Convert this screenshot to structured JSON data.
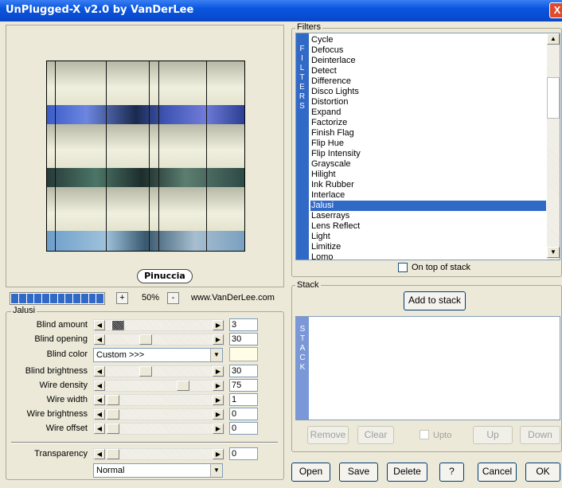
{
  "window": {
    "title": "UnPlugged-X v2.0 by VanDerLee",
    "close_label": "X"
  },
  "preview": {
    "logo_text": "Pinuccia"
  },
  "zoom": {
    "minus": "-",
    "plus": "+",
    "value": "50%"
  },
  "website": "www.VanDerLee.com",
  "jalusi": {
    "group_title": "Jalusi",
    "params": [
      {
        "label": "Blind amount",
        "value": "3",
        "level": 0.05
      },
      {
        "label": "Blind opening",
        "value": "30",
        "level": 0.35
      },
      {
        "label": "Blind brightness",
        "value": "30",
        "level": 0.35
      },
      {
        "label": "Wire density",
        "value": "75",
        "level": 0.75
      },
      {
        "label": "Wire width",
        "value": "1",
        "level": 0.0
      },
      {
        "label": "Wire brightness",
        "value": "0",
        "level": 0.0
      },
      {
        "label": "Wire offset",
        "value": "0",
        "level": 0.0
      }
    ],
    "blind_color_label": "Blind color",
    "blind_color_value": "Custom >>>",
    "blind_color_swatch": "#fffde6",
    "transparency_label": "Transparency",
    "transparency_value": "0",
    "blend_mode": "Normal"
  },
  "filters": {
    "group_title": "Filters",
    "side_label": "FILTERS",
    "items": [
      "Cycle",
      "Defocus",
      "Deinterlace",
      "Detect",
      "Difference",
      "Disco Lights",
      "Distortion",
      "Expand",
      "Factorize",
      "Finish Flag",
      "Flip Hue",
      "Flip Intensity",
      "Grayscale",
      "Hilight",
      "Ink Rubber",
      "Interlace",
      "Jalusi",
      "Laserrays",
      "Lens Reflect",
      "Light",
      "Limitize",
      "Lomo"
    ],
    "selected": "Jalusi",
    "on_top_label": "On top of stack"
  },
  "stack": {
    "group_title": "Stack",
    "add_label": "Add to stack",
    "side_label": "STACK",
    "remove_label": "Remove",
    "clear_label": "Clear",
    "upto_label": "Upto",
    "up_label": "Up",
    "down_label": "Down"
  },
  "buttons": {
    "open": "Open",
    "save": "Save",
    "delete": "Delete",
    "help": "?",
    "cancel": "Cancel",
    "ok": "OK"
  },
  "colors": {
    "accent": "#3169c6",
    "title_bar": "#0a55de",
    "panel": "#ece9d8"
  }
}
